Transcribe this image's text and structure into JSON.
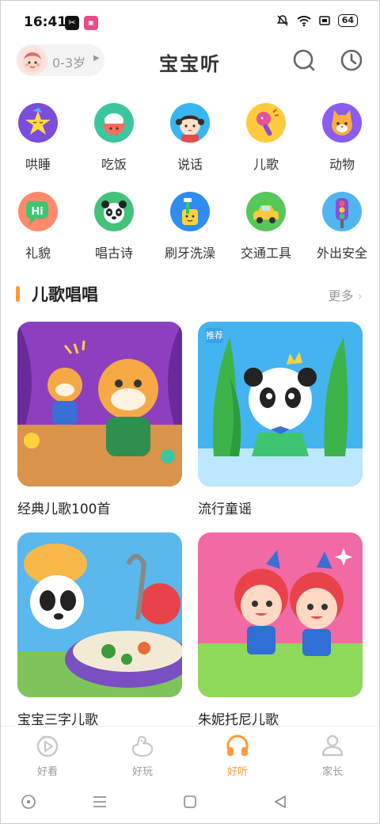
{
  "status_bar": {
    "time": "16:41",
    "battery": "64"
  },
  "header": {
    "age_label": "0-3岁",
    "title": "宝宝听"
  },
  "categories": [
    {
      "label": "哄睡",
      "color": "#7b4ddb"
    },
    {
      "label": "吃饭",
      "color": "#3cc6a0"
    },
    {
      "label": "说话",
      "color": "#38b6f0"
    },
    {
      "label": "儿歌",
      "color": "#f5a623"
    },
    {
      "label": "动物",
      "color": "#8a5cf0"
    },
    {
      "label": "礼貌",
      "color": "#ff6b6b"
    },
    {
      "label": "唱古诗",
      "color": "#44c27a"
    },
    {
      "label": "刷牙洗澡",
      "color": "#2f8cf0"
    },
    {
      "label": "交通工具",
      "color": "#56c85a"
    },
    {
      "label": "外出安全",
      "color": "#4fb6f0"
    }
  ],
  "section": {
    "title": "儿歌唱唱",
    "more": "更多"
  },
  "cards": [
    {
      "name": "经典儿歌100首"
    },
    {
      "name": "流行童谣",
      "tag": "推荐"
    },
    {
      "name": "宝宝三字儿歌"
    },
    {
      "name": "朱妮托尼儿歌"
    }
  ],
  "tabs": [
    {
      "label": "好看"
    },
    {
      "label": "好玩"
    },
    {
      "label": "好听"
    },
    {
      "label": "家长"
    }
  ],
  "accent": "#ff9b3a"
}
